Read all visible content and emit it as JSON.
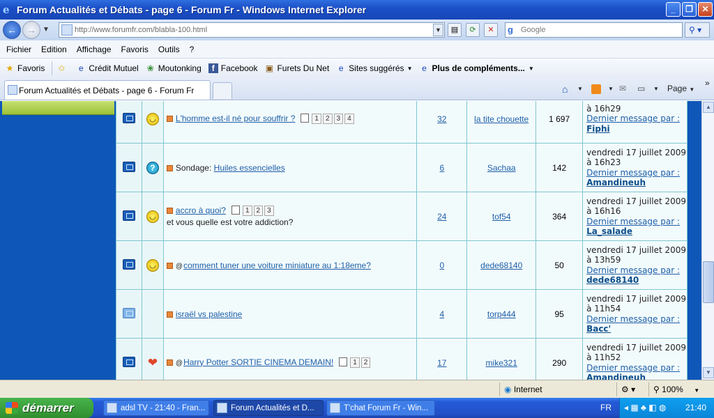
{
  "window": {
    "title": "Forum Actualités et Débats - page 6 - Forum Fr - Windows Internet Explorer",
    "minimize": "_",
    "restore": "❐",
    "close": "✕"
  },
  "address": {
    "url": "http://www.forumfr.com/blabla-100.html",
    "search_placeholder": "Google"
  },
  "menu": [
    "Fichier",
    "Edition",
    "Affichage",
    "Favoris",
    "Outils",
    "?"
  ],
  "favorites": {
    "label": "Favoris",
    "items": [
      "Crédit Mutuel",
      "Moutonking",
      "Facebook",
      "Furets Du Net",
      "Sites suggérés",
      "Plus de compléments..."
    ]
  },
  "tab": {
    "label": "Forum Actualités et Débats - page 6 - Forum Fr",
    "page_menu": "Page"
  },
  "topics": [
    {
      "icon": "folder-icon",
      "mood": "smiley-icon",
      "prefix": "",
      "attachment": false,
      "title": "L'homme est-il né pour souffrir ?",
      "subtitle": "",
      "pages": [
        "1",
        "2",
        "3",
        "4"
      ],
      "replies": "32",
      "author": "la tite chouette",
      "views": "1 697",
      "last_date": "",
      "last_time": "à 16h29",
      "last_label": "Dernier message par :",
      "last_user": "Fiphi"
    },
    {
      "icon": "poll-folder-icon",
      "mood": "question-icon",
      "prefix": "Sondage:",
      "attachment": false,
      "title": "Huiles essencielles",
      "subtitle": "",
      "pages": [],
      "replies": "6",
      "author": "Sachaa",
      "views": "142",
      "last_date": "vendredi 17 juillet 2009",
      "last_time": "à 16h23",
      "last_label": "Dernier message par :",
      "last_user": "Amandineuh"
    },
    {
      "icon": "folder-icon",
      "mood": "smiley-icon",
      "prefix": "",
      "attachment": false,
      "title": "accro à quoi?",
      "subtitle": "et vous quelle est votre addiction?",
      "pages": [
        "1",
        "2",
        "3"
      ],
      "replies": "24",
      "author": "tof54",
      "views": "364",
      "last_date": "vendredi 17 juillet 2009",
      "last_time": "à 16h16",
      "last_label": "Dernier message par :",
      "last_user": "La_salade"
    },
    {
      "icon": "folder-icon",
      "mood": "smiley-icon",
      "prefix": "",
      "attachment": true,
      "title": "comment tuner une voiture miniature au 1:18eme?",
      "subtitle": "",
      "pages": [],
      "replies": "0",
      "author": "dede68140",
      "views": "50",
      "last_date": "vendredi 17 juillet 2009",
      "last_time": "à 13h59",
      "last_label": "Dernier message par :",
      "last_user": "dede68140"
    },
    {
      "icon": "locked-folder-icon",
      "mood": "",
      "prefix": "",
      "attachment": false,
      "title": "israël vs palestine",
      "subtitle": "",
      "pages": [],
      "replies": "4",
      "author": "torp444",
      "views": "95",
      "last_date": "vendredi 17 juillet 2009",
      "last_time": "à 11h54",
      "last_label": "Dernier message par :",
      "last_user": "Bacc'"
    },
    {
      "icon": "folder-icon",
      "mood": "heart-icon",
      "prefix": "",
      "attachment": true,
      "title": "Harry Potter SORTIE CINEMA DEMAIN!",
      "subtitle": "",
      "pages": [
        "1",
        "2"
      ],
      "replies": "17",
      "author": "mike321",
      "views": "290",
      "last_date": "vendredi 17 juillet 2009",
      "last_time": "à 11h52",
      "last_label": "Dernier message par :",
      "last_user": "Amandineuh"
    }
  ],
  "status": {
    "zone": "Internet",
    "zoom": "100%"
  },
  "taskbar": {
    "start": "démarrer",
    "tasks": [
      "adsl TV - 21:40 - Fran...",
      "Forum Actualités et D...",
      "T'chat Forum Fr - Win..."
    ],
    "lang": "FR",
    "clock": "21:40"
  },
  "colors": {
    "accent": "#0e57b8",
    "link": "#1f5fa8",
    "table_border": "#7fc7cf"
  }
}
